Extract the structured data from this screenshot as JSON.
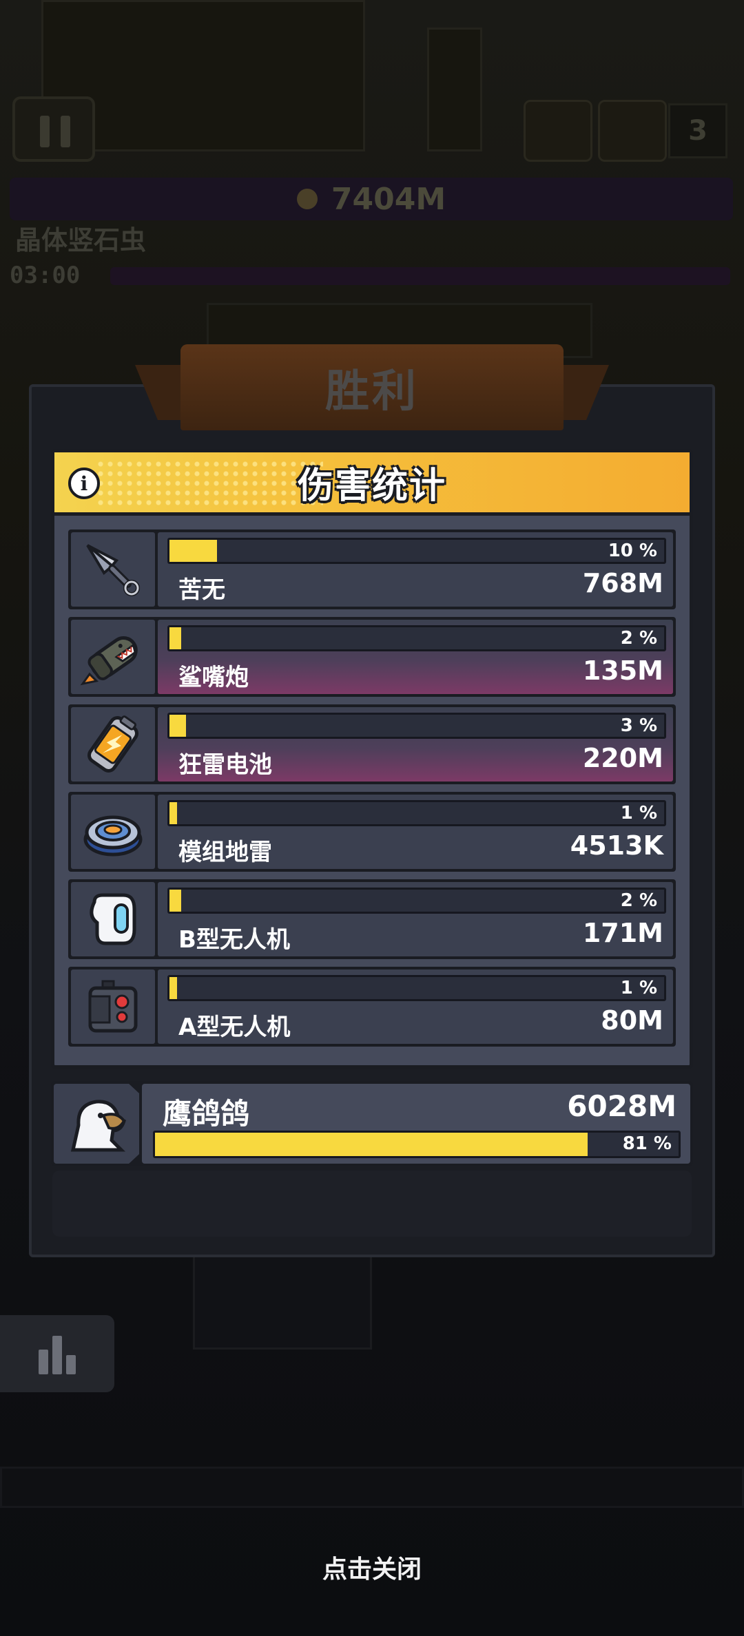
{
  "hud": {
    "gold": "7404M",
    "boss_name": "晶体竖石虫",
    "timer": "03:00",
    "counter": "3"
  },
  "result_banner": "胜利",
  "damage_panel": {
    "title": "伤害统计",
    "info_icon": "info-icon",
    "rows": [
      {
        "name": "苦无",
        "percent_label": "10 %",
        "fraction": 0.1,
        "amount": "768M",
        "icon": "kunai-icon",
        "highlight": false
      },
      {
        "name": "鲨嘴炮",
        "percent_label": "2 %",
        "fraction": 0.02,
        "amount": "135M",
        "icon": "shark-cannon-icon",
        "highlight": true
      },
      {
        "name": "狂雷电池",
        "percent_label": "3 %",
        "fraction": 0.03,
        "amount": "220M",
        "icon": "thunder-battery-icon",
        "highlight": true
      },
      {
        "name": "模组地雷",
        "percent_label": "1 %",
        "fraction": 0.01,
        "amount": "4513K",
        "icon": "module-mine-icon",
        "highlight": false
      },
      {
        "name": "B型无人机",
        "percent_label": "2 %",
        "fraction": 0.02,
        "amount": "171M",
        "icon": "drone-b-icon",
        "highlight": false
      },
      {
        "name": "A型无人机",
        "percent_label": "1 %",
        "fraction": 0.01,
        "amount": "80M",
        "icon": "drone-a-icon",
        "highlight": false
      }
    ]
  },
  "total": {
    "name": "鹰鸽鸽",
    "amount": "6028M",
    "percent_label": "81 %",
    "fraction": 0.81,
    "avatar_icon": "eagle-avatar-icon"
  },
  "close_hint": "点击关闭",
  "colors": {
    "bar_fill": "#f8d93f",
    "header_yellow": "#f5c03c",
    "panel": "#454a5b",
    "highlight_magenta": "#7c3a66"
  }
}
